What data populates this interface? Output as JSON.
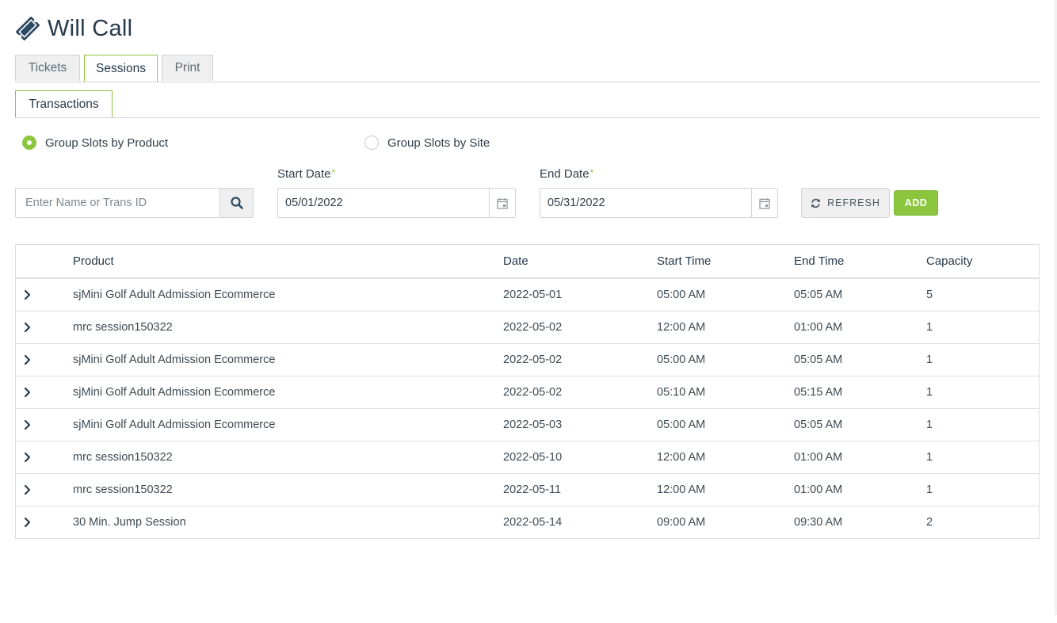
{
  "header": {
    "title": "Will Call",
    "logo_icon": "ticket-icon"
  },
  "tabs": [
    {
      "label": "Tickets",
      "active": false
    },
    {
      "label": "Sessions",
      "active": true
    },
    {
      "label": "Print",
      "active": false
    }
  ],
  "subtabs": [
    {
      "label": "Transactions",
      "active": true
    }
  ],
  "grouping": {
    "by_product": {
      "label": "Group Slots by Product",
      "checked": true
    },
    "by_site": {
      "label": "Group Slots by Site",
      "checked": false
    }
  },
  "filters": {
    "search": {
      "placeholder": "Enter Name or Trans ID",
      "value": "",
      "icon": "search-icon"
    },
    "start_date": {
      "label": "Start Date",
      "required_mark": "*",
      "value": "05/01/2022",
      "icon": "calendar-icon"
    },
    "end_date": {
      "label": "End Date",
      "required_mark": "*",
      "value": "05/31/2022",
      "icon": "calendar-icon"
    }
  },
  "actions": {
    "refresh_label": "REFRESH",
    "refresh_icon": "refresh-icon",
    "add_label": "ADD"
  },
  "colors": {
    "accent": "#8cc63f",
    "title": "#26394a",
    "border": "#cfd4d8"
  },
  "grid": {
    "columns": [
      "Product",
      "Date",
      "Start Time",
      "End Time",
      "Capacity"
    ],
    "rows": [
      {
        "product": "sjMini Golf Adult Admission Ecommerce",
        "date": "2022-05-01",
        "start": "05:00 AM",
        "end": "05:05 AM",
        "capacity": "5"
      },
      {
        "product": "mrc session150322",
        "date": "2022-05-02",
        "start": "12:00 AM",
        "end": "01:00 AM",
        "capacity": "1"
      },
      {
        "product": "sjMini Golf Adult Admission Ecommerce",
        "date": "2022-05-02",
        "start": "05:00 AM",
        "end": "05:05 AM",
        "capacity": "1"
      },
      {
        "product": "sjMini Golf Adult Admission Ecommerce",
        "date": "2022-05-02",
        "start": "05:10 AM",
        "end": "05:15 AM",
        "capacity": "1"
      },
      {
        "product": "sjMini Golf Adult Admission Ecommerce",
        "date": "2022-05-03",
        "start": "05:00 AM",
        "end": "05:05 AM",
        "capacity": "1"
      },
      {
        "product": "mrc session150322",
        "date": "2022-05-10",
        "start": "12:00 AM",
        "end": "01:00 AM",
        "capacity": "1"
      },
      {
        "product": "mrc session150322",
        "date": "2022-05-11",
        "start": "12:00 AM",
        "end": "01:00 AM",
        "capacity": "1"
      },
      {
        "product": "30 Min. Jump Session",
        "date": "2022-05-14",
        "start": "09:00 AM",
        "end": "09:30 AM",
        "capacity": "2"
      }
    ]
  }
}
